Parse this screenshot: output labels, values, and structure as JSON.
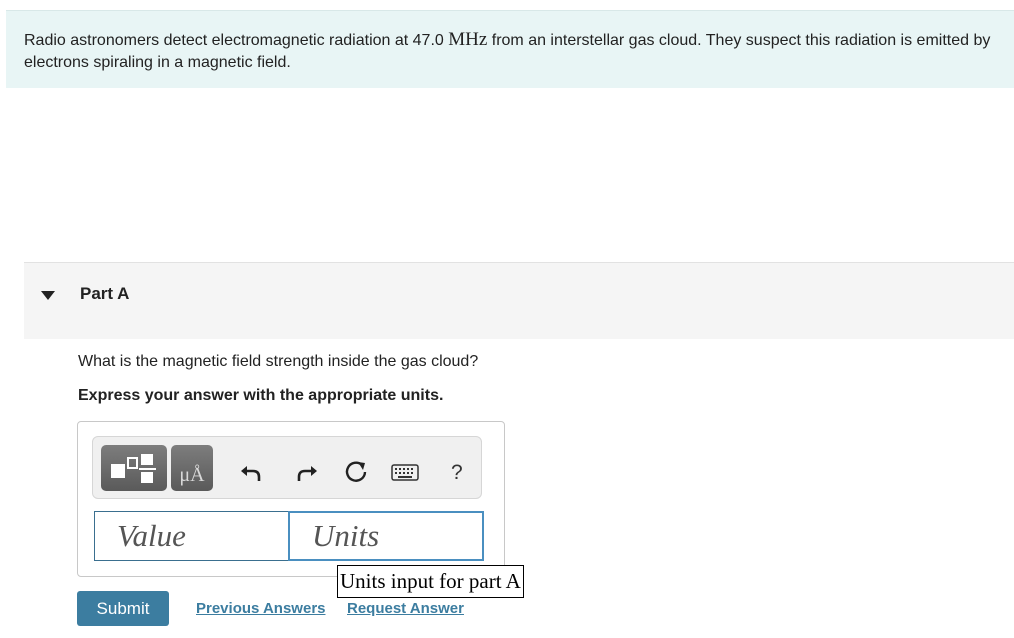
{
  "problem": {
    "text_before": "Radio astronomers detect electromagnetic radiation at 47.0 ",
    "unit": "MHz",
    "text_after": " from an interstellar gas cloud. They suspect this radiation is emitted by electrons spiraling in a magnetic field."
  },
  "part": {
    "title": "Part A",
    "question": "What is the magnetic field strength inside the gas cloud?",
    "instruction": "Express your answer with the appropriate units."
  },
  "toolbar": {
    "templates_icon": "templates-icon",
    "units_label": "μÅ",
    "undo_icon": "undo-icon",
    "redo_icon": "redo-icon",
    "reset_icon": "reset-icon",
    "keyboard_icon": "keyboard-icon",
    "help_label": "?"
  },
  "inputs": {
    "value_placeholder": "Value",
    "units_placeholder": "Units",
    "units_tooltip": "Units input for part A"
  },
  "actions": {
    "submit_label": "Submit",
    "previous_answers_label": "Previous Answers",
    "request_answer_label": "Request Answer"
  },
  "colors": {
    "problem_bg": "#e8f5f5",
    "accent": "#3c7da0",
    "part_header_bg": "#f5f5f5"
  }
}
